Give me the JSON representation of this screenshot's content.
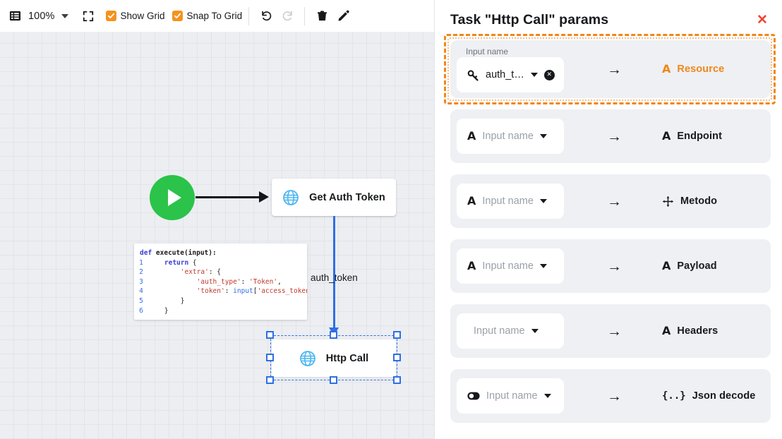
{
  "toolbar": {
    "menu_icon": "list-panel-icon",
    "zoom_level": "100%",
    "zoom_caret_icon": "chevron-down-icon",
    "fit_icon": "fit-screen-icon",
    "show_grid_label": "Show Grid",
    "show_grid_checked": true,
    "snap_grid_label": "Snap To Grid",
    "snap_grid_checked": true,
    "undo_icon": "undo-icon",
    "redo_icon": "redo-icon",
    "redo_disabled": true,
    "delete_icon": "trash-icon",
    "edit_icon": "pencil-icon",
    "accent_color": "#f5921e"
  },
  "canvas": {
    "start_node": {
      "icon": "play-icon",
      "color": "#2bc34a"
    },
    "nodes": [
      {
        "label": "Get Auth Token",
        "icon": "globe-icon"
      },
      {
        "label": "Http Call",
        "icon": "globe-icon",
        "selected": true
      }
    ],
    "edge_label": "auth_token",
    "edge_color": "#2f6fe4",
    "code": {
      "header": "def execute(input):",
      "lines": [
        {
          "num": "1",
          "text": "    return {"
        },
        {
          "num": "2",
          "text": "        'extra': {"
        },
        {
          "num": "3",
          "text": "            'auth_type': 'Token',"
        },
        {
          "num": "4",
          "text": "            'token': input['access_token']"
        },
        {
          "num": "5",
          "text": "        }"
        },
        {
          "num": "6",
          "text": "    }"
        }
      ]
    }
  },
  "panel": {
    "title": "Task \"Http Call\" params",
    "close_icon": "close-icon",
    "close_color": "#f0452f",
    "highlight_color": "#f0871b",
    "rows": [
      {
        "input_label": "Input name",
        "chip_icon": "key-icon",
        "chip_value": "auth_t…",
        "chip_filled": true,
        "has_clear": true,
        "clear_icon": "clear-circle-icon",
        "caret_icon": "chevron-down-icon",
        "arrow_icon": "arrow-right-icon",
        "target_icon": "text-letter-icon",
        "target_label": "Resource",
        "highlighted": true
      },
      {
        "chip_icon": "text-letter-icon",
        "chip_value": "Input name",
        "chip_filled": false,
        "has_clear": false,
        "caret_icon": "chevron-down-icon",
        "arrow_icon": "arrow-right-icon",
        "target_icon": "text-letter-icon",
        "target_label": "Endpoint",
        "highlighted": false
      },
      {
        "chip_icon": "text-letter-icon",
        "chip_value": "Input name",
        "chip_filled": false,
        "has_clear": false,
        "caret_icon": "chevron-down-icon",
        "arrow_icon": "arrow-right-icon",
        "target_icon": "select-move-icon",
        "target_label": "Metodo",
        "highlighted": false
      },
      {
        "chip_icon": "text-letter-icon",
        "chip_value": "Input name",
        "chip_filled": false,
        "has_clear": false,
        "caret_icon": "chevron-down-icon",
        "arrow_icon": "arrow-right-icon",
        "target_icon": "text-letter-icon",
        "target_label": "Payload",
        "highlighted": false
      },
      {
        "chip_icon": "none",
        "chip_value": "Input name",
        "chip_filled": false,
        "has_clear": false,
        "caret_icon": "chevron-down-icon",
        "arrow_icon": "arrow-right-icon",
        "target_icon": "text-letter-icon",
        "target_label": "Headers",
        "highlighted": false
      },
      {
        "chip_icon": "toggle-icon",
        "chip_value": "Input name",
        "chip_filled": false,
        "has_clear": false,
        "caret_icon": "chevron-down-icon",
        "arrow_icon": "arrow-right-icon",
        "target_icon": "json-braces-icon",
        "target_label": "Json decode",
        "highlighted": false
      }
    ]
  }
}
